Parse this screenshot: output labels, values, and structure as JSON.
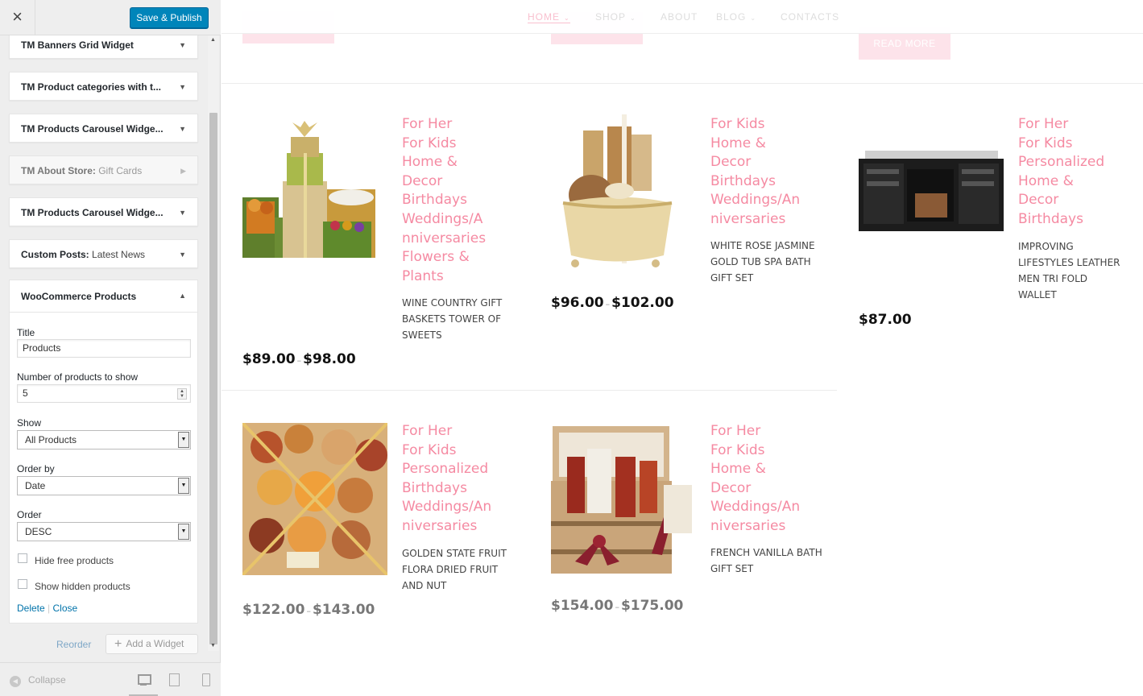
{
  "sidebar": {
    "close_icon": "×",
    "publish_label": "Save & Publish",
    "widgets": [
      {
        "title": "TM Banners Grid Widget",
        "subtitle": ""
      },
      {
        "title": "TM Product categories with t...",
        "subtitle": ""
      },
      {
        "title": "TM Products Carousel Widge...",
        "subtitle": ""
      },
      {
        "title": "TM About Store:",
        "subtitle": " Gift Cards"
      },
      {
        "title": "TM Products Carousel Widge...",
        "subtitle": ""
      },
      {
        "title": "Custom Posts:",
        "subtitle": " Latest News"
      }
    ],
    "woo": {
      "title": "WooCommerce Products",
      "title_label": "Title",
      "title_value": "Products",
      "number_label": "Number of products to show",
      "number_value": "5",
      "show_label": "Show",
      "show_value": "All Products",
      "orderby_label": "Order by",
      "orderby_value": "Date",
      "order_label": "Order",
      "order_value": "DESC",
      "hide_free_label": "Hide free products",
      "show_hidden_label": "Show hidden products",
      "delete_label": "Delete",
      "separator": " | ",
      "close_label": "Close"
    },
    "reorder_label": "Reorder",
    "add_widget_label": "Add a Widget",
    "collapse_label": "Collapse"
  },
  "preview": {
    "nav": [
      "HOME",
      "SHOP",
      "ABOUT",
      "BLOG",
      "CONTACTS"
    ],
    "read_more_label": "READ MORE",
    "products": [
      {
        "categories": [
          "For Her",
          "For Kids",
          "Home &",
          "Decor",
          "Birthdays",
          "Weddings/A",
          "nniversaries",
          "Flowers &",
          "Plants"
        ],
        "name": "WINE COUNTRY GIFT BASKETS TOWER OF SWEETS",
        "price_low": "$89.00",
        "price_high": "$98.00",
        "dash": "–"
      },
      {
        "categories": [
          "For Kids",
          "Home &",
          "Decor",
          "Birthdays",
          "Weddings/An",
          "niversaries"
        ],
        "name": "WHITE ROSE JASMINE GOLD TUB SPA BATH GIFT SET",
        "price_low": "$96.00",
        "price_high": "$102.00",
        "dash": "–"
      },
      {
        "categories": [
          "For Her",
          "For Kids",
          "Personalized",
          "Home &",
          "Decor",
          "Birthdays"
        ],
        "name": "IMPROVING LIFESTYLES LEATHER MEN TRI FOLD WALLET",
        "price": "$87.00"
      },
      {
        "categories": [
          "For Her",
          "For Kids",
          "Personalized",
          "Birthdays",
          "Weddings/An",
          "niversaries"
        ],
        "name": "GOLDEN STATE FRUIT FLORA DRIED FRUIT AND NUT",
        "price_low": "$122.00",
        "price_high": "$143.00",
        "dash": "–"
      },
      {
        "categories": [
          "For Her",
          "For Kids",
          "Home &",
          "Decor",
          "Weddings/An",
          "niversaries"
        ],
        "name": "FRENCH VANILLA BATH GIFT SET",
        "price_low": "$154.00",
        "price_high": "$175.00",
        "dash": "–"
      }
    ]
  },
  "colors": {
    "accent_pink": "#f58aa2",
    "publish_blue": "#0085ba",
    "link_blue": "#0073aa"
  }
}
